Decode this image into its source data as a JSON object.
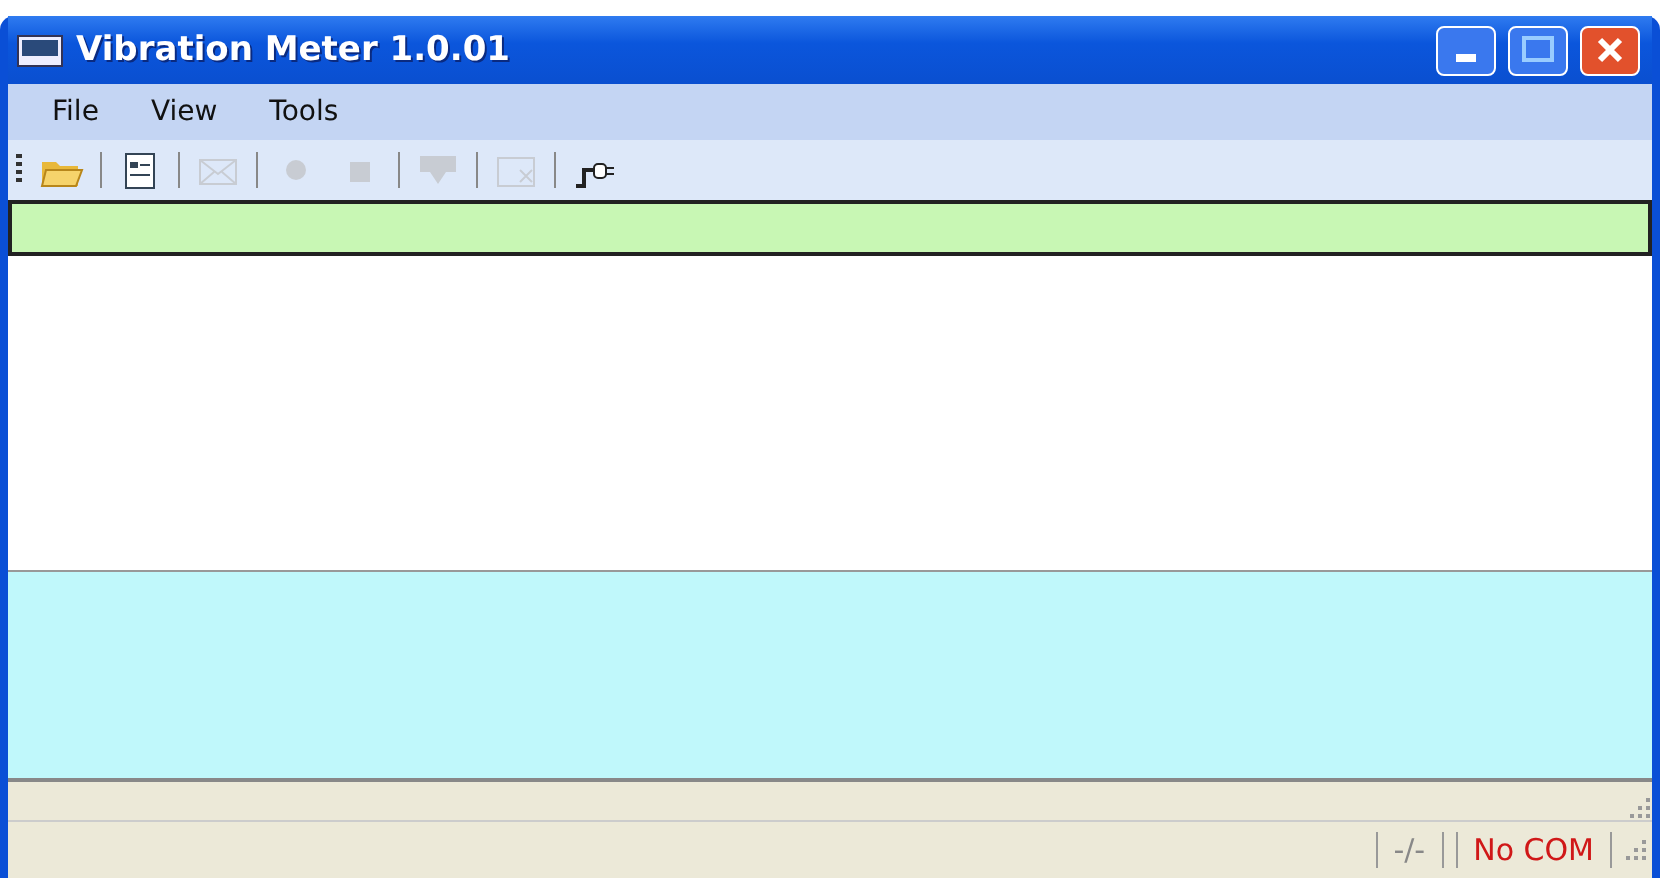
{
  "window": {
    "title": "Vibration Meter 1.0.01"
  },
  "menu": [
    {
      "label": "File"
    },
    {
      "label": "View"
    },
    {
      "label": "Tools"
    }
  ],
  "toolbar": [
    {
      "kind": "open",
      "disabled": false
    },
    {
      "kind": "document",
      "disabled": false
    },
    {
      "kind": "envelope",
      "disabled": true
    },
    {
      "kind": "record",
      "disabled": true
    },
    {
      "kind": "stop",
      "disabled": true
    },
    {
      "kind": "download",
      "disabled": true
    },
    {
      "kind": "delete",
      "disabled": true
    },
    {
      "kind": "plug",
      "disabled": false
    }
  ],
  "status_bar": [
    {
      "text": "-/-",
      "kind": "plain"
    },
    {
      "text": "No COM",
      "kind": "alert"
    }
  ]
}
